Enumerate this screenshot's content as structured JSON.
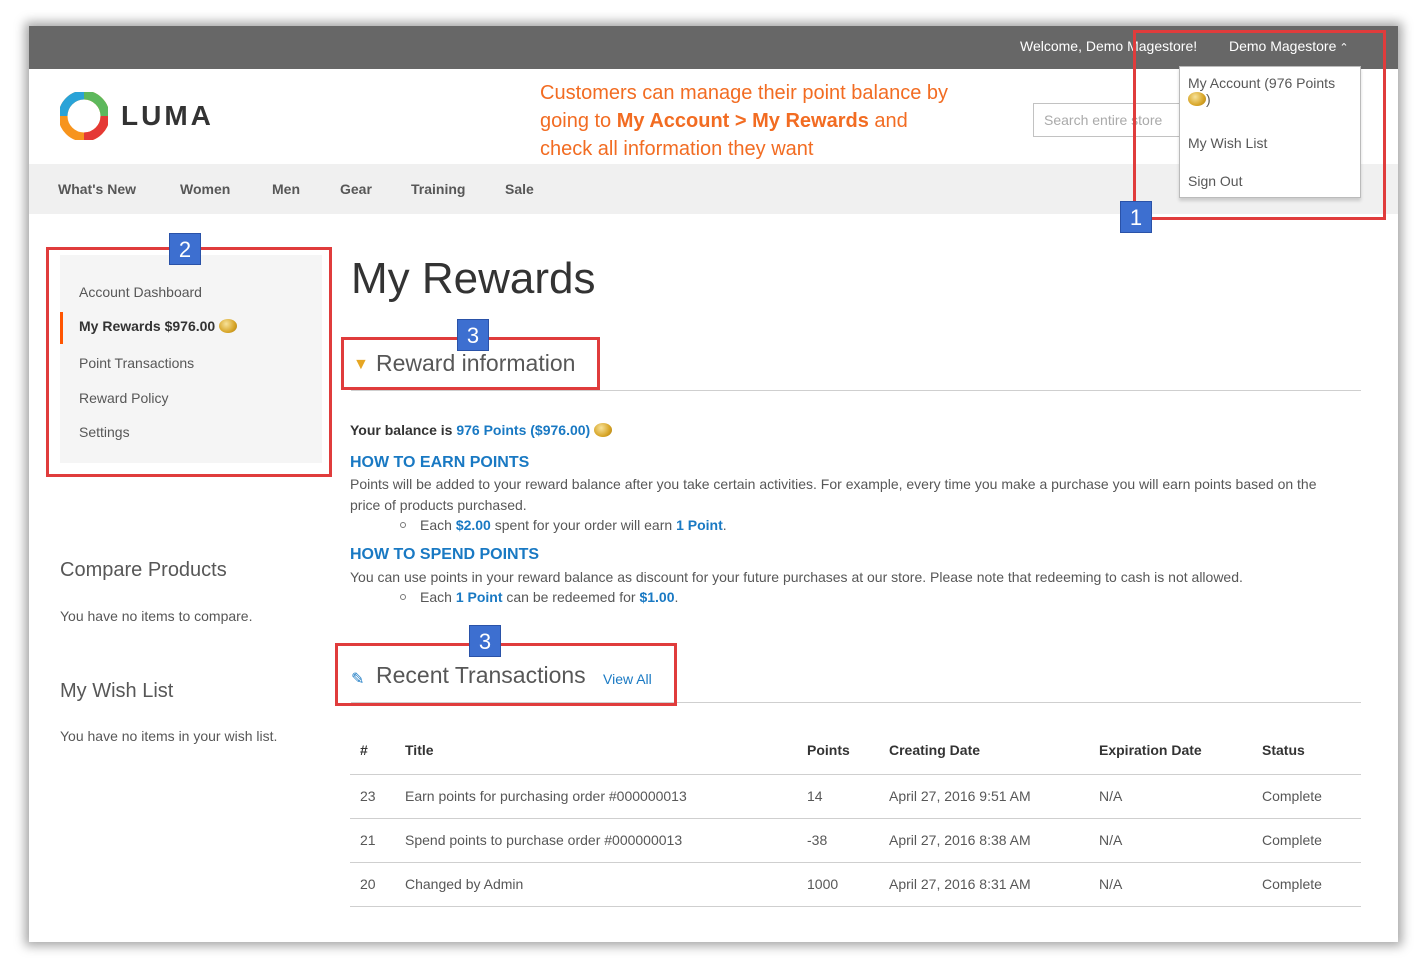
{
  "header": {
    "welcome": "Welcome, Demo Magestore!",
    "account_name": "Demo Magestore",
    "logo_text": "LUMA",
    "search_placeholder": "Search entire store",
    "callout_line1": "Customers can manage their point balance by",
    "callout_line2_pre": "going to ",
    "callout_line2_bold": "My Account > My Rewards",
    "callout_line2_post": " and",
    "callout_line3": "check all information they want"
  },
  "account_dropdown": {
    "my_account_line1": "My Account (976 Points",
    "my_account_line2": ")",
    "wish_list": "My Wish List",
    "sign_out": "Sign Out"
  },
  "nav": [
    "What's New",
    "Women",
    "Men",
    "Gear",
    "Training",
    "Sale"
  ],
  "sidebar": {
    "items": [
      "Account Dashboard",
      "My Rewards $976.00",
      "Point Transactions",
      "Reward Policy",
      "Settings"
    ],
    "compare_title": "Compare Products",
    "compare_text": "You have no items to compare.",
    "wishlist_title": "My Wish List",
    "wishlist_text": "You have no items in your wish list."
  },
  "main": {
    "title": "My Rewards",
    "reward_info_title": "Reward information",
    "balance_label": "Your balance is ",
    "balance_value": "976 Points ($976.00)",
    "earn_title": "HOW TO EARN POINTS",
    "earn_text": "Points will be added to your reward balance after you take certain activities. For example, every time you make a purchase you will earn points based on the price of products purchased.",
    "earn_bullet_pre": "Each ",
    "earn_bullet_amount": "$2.00",
    "earn_bullet_mid": " spent for your order will earn ",
    "earn_bullet_points": "1 Point",
    "earn_bullet_post": ".",
    "spend_title": "HOW TO SPEND POINTS",
    "spend_text": "You can use points in your reward balance as discount for your future purchases at our store. Please note that redeeming to cash is not allowed.",
    "spend_bullet_pre": "Each ",
    "spend_bullet_points": "1 Point",
    "spend_bullet_mid": " can be redeemed for ",
    "spend_bullet_amount": "$1.00",
    "spend_bullet_post": ".",
    "transactions_title": "Recent Transactions",
    "view_all": "View All"
  },
  "transactions": {
    "headers": [
      "#",
      "Title",
      "Points",
      "Creating Date",
      "Expiration Date",
      "Status"
    ],
    "rows": [
      [
        "23",
        "Earn points for purchasing order #000000013",
        "14",
        "April 27, 2016 9:51 AM",
        "N/A",
        "Complete"
      ],
      [
        "21",
        "Spend points to purchase order #000000013",
        "-38",
        "April 27, 2016 8:38 AM",
        "N/A",
        "Complete"
      ],
      [
        "20",
        "Changed by Admin",
        "1000",
        "April 27, 2016 8:31 AM",
        "N/A",
        "Complete"
      ]
    ]
  },
  "annotations": {
    "badge1": "1",
    "badge2": "2",
    "badge3a": "3",
    "badge3b": "3"
  },
  "colors": {
    "topbar": "#676767",
    "callout": "#f26c22",
    "link": "#1979c3",
    "annotation_red": "#e03c3c",
    "badge_blue": "#3d6fd0"
  }
}
